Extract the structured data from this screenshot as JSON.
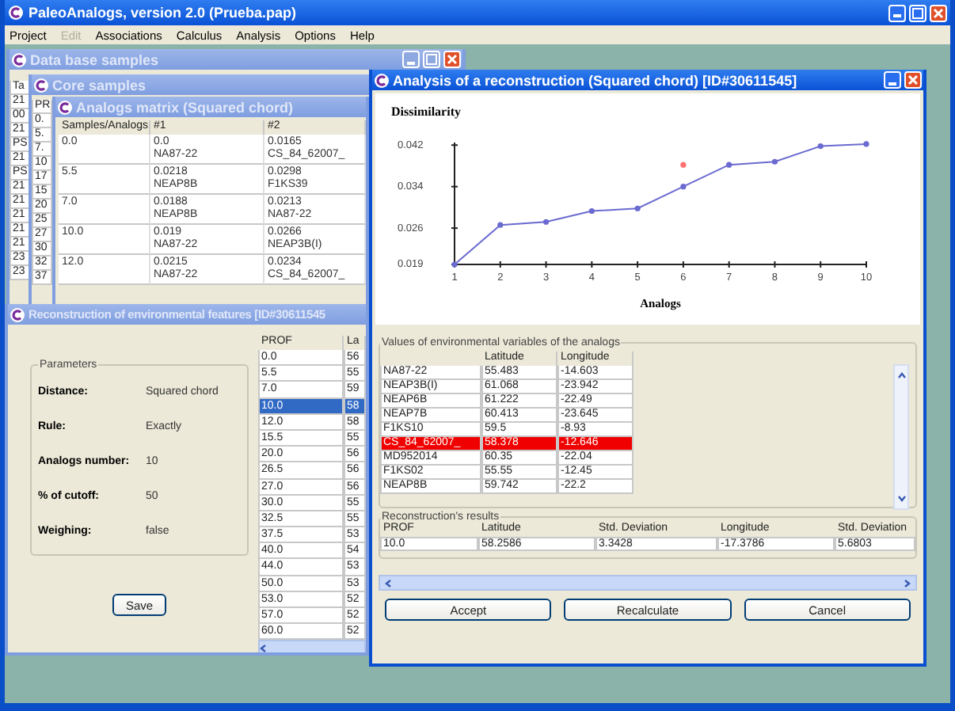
{
  "window": {
    "title": "PaleoAnalogs, version 2.0 (Prueba.pap)"
  },
  "menu": [
    {
      "label": "Project",
      "disabled": false
    },
    {
      "label": "Edit",
      "disabled": true
    },
    {
      "label": "Associations",
      "disabled": false
    },
    {
      "label": "Calculus",
      "disabled": false
    },
    {
      "label": "Analysis",
      "disabled": false
    },
    {
      "label": "Options",
      "disabled": false
    },
    {
      "label": "Help",
      "disabled": false
    }
  ],
  "database_window": {
    "title": "Data base samples",
    "column_1": [
      "Ta",
      "21",
      "00",
      "21",
      "PS",
      "21",
      "PS",
      "21",
      "21",
      "21",
      "21",
      "21",
      "23",
      "23"
    ]
  },
  "core_window": {
    "title": "Core samples",
    "column_1": [
      "PR",
      "0.",
      "5.",
      "7.",
      "10",
      "17",
      "15",
      "20",
      "25",
      "27",
      "30",
      "32",
      "37"
    ]
  },
  "matrix_window": {
    "title": "Analogs matrix (Squared chord)",
    "columns": [
      "Samples/Analogs",
      "#1",
      "#2"
    ],
    "rows": [
      {
        "cells": [
          {
            "value": "0.0"
          },
          {
            "value": "0.0",
            "analog": "NA87-22"
          },
          {
            "value": "0.0165",
            "analog": "CS_84_62007_"
          }
        ]
      },
      {
        "cells": [
          {
            "value": "5.5"
          },
          {
            "value": "0.0218",
            "analog": "NEAP8B"
          },
          {
            "value": "0.0298",
            "analog": "F1KS39"
          }
        ]
      },
      {
        "cells": [
          {
            "value": "7.0"
          },
          {
            "value": "0.0188",
            "analog": "NEAP8B"
          },
          {
            "value": "0.0213",
            "analog": "NA87-22"
          }
        ]
      },
      {
        "cells": [
          {
            "value": "10.0"
          },
          {
            "value": "0.019",
            "analog": "NA87-22"
          },
          {
            "value": "0.0266",
            "analog": "NEAP3B(I)"
          }
        ]
      },
      {
        "cells": [
          {
            "value": "12.0"
          },
          {
            "value": "0.0215",
            "analog": "NA87-22"
          },
          {
            "value": "0.0234",
            "analog": "CS_84_62007_"
          }
        ]
      }
    ]
  },
  "reconstruction_window": {
    "title": "Reconstruction of environmental features [ID#30611545",
    "parameters": {
      "title": "Parameters",
      "items": [
        {
          "label": "Distance:",
          "value": "Squared chord"
        },
        {
          "label": "Rule:",
          "value": "Exactly"
        },
        {
          "label": "Analogs number:",
          "value": "10"
        },
        {
          "label": "% of cutoff:",
          "value": "50"
        },
        {
          "label": "Weighing:",
          "value": "false"
        }
      ]
    },
    "save_button": "Save",
    "columns": [
      "PROF",
      "La"
    ],
    "rows": [
      {
        "prof": "0.0",
        "column_2": "56",
        "selected": false
      },
      {
        "prof": "5.5",
        "column_2": "55",
        "selected": false
      },
      {
        "prof": "7.0",
        "column_2": "59",
        "selected": false
      },
      {
        "prof": "10.0",
        "column_2": "58",
        "selected": true
      },
      {
        "prof": "12.0",
        "column_2": "58",
        "selected": false
      },
      {
        "prof": "15.5",
        "column_2": "55",
        "selected": false
      },
      {
        "prof": "20.0",
        "column_2": "56",
        "selected": false
      },
      {
        "prof": "26.5",
        "column_2": "56",
        "selected": false
      },
      {
        "prof": "27.0",
        "column_2": "56",
        "selected": false
      },
      {
        "prof": "30.0",
        "column_2": "55",
        "selected": false
      },
      {
        "prof": "32.5",
        "column_2": "55",
        "selected": false
      },
      {
        "prof": "37.5",
        "column_2": "53",
        "selected": false
      },
      {
        "prof": "40.0",
        "column_2": "54",
        "selected": false
      },
      {
        "prof": "44.0",
        "column_2": "53",
        "selected": false
      },
      {
        "prof": "50.0",
        "column_2": "53",
        "selected": false
      },
      {
        "prof": "53.0",
        "column_2": "52",
        "selected": false
      },
      {
        "prof": "57.0",
        "column_2": "52",
        "selected": false
      },
      {
        "prof": "60.0",
        "column_2": "52",
        "selected": false
      }
    ]
  },
  "analysis_window": {
    "title": "Analysis of a reconstruction (Squared chord) [ID#30611545]",
    "chart_data": {
      "type": "line",
      "title": "Dissimilarity",
      "xlabel": "Analogs",
      "x": [
        1,
        2,
        3,
        4,
        5,
        6,
        7,
        8,
        9,
        10
      ],
      "series": [
        {
          "color": "#6a6ad0",
          "marker": "circle",
          "values": [
            0.019,
            0.0266,
            0.0272,
            0.0293,
            0.0298,
            0.034,
            0.0382,
            0.0388,
            0.0418,
            0.0422
          ]
        },
        {
          "color": "#ff7070",
          "marker": "circle",
          "values": [
            null,
            null,
            null,
            null,
            null,
            0.0382,
            null,
            null,
            null,
            null
          ]
        }
      ],
      "xlim": [
        1,
        10
      ],
      "ylim": [
        0.019,
        0.0425
      ],
      "xticks": [
        1,
        2,
        3,
        4,
        5,
        6,
        7,
        8,
        9,
        10
      ],
      "yticks": [
        0.019,
        0.026,
        0.034,
        0.042
      ]
    },
    "values_group": {
      "title": "Values of environmental variables of the analogs",
      "columns": [
        "Latitude",
        "Longitude"
      ],
      "rows": [
        {
          "name": "NA87-22",
          "latitude": "55.483",
          "longitude": "-14.603",
          "selected": false
        },
        {
          "name": "NEAP3B(I)",
          "latitude": "61.068",
          "longitude": "-23.942",
          "selected": false
        },
        {
          "name": "NEAP6B",
          "latitude": "61.222",
          "longitude": "-22.49",
          "selected": false
        },
        {
          "name": "NEAP7B",
          "latitude": "60.413",
          "longitude": "-23.645",
          "selected": false
        },
        {
          "name": "F1KS10",
          "latitude": "59.5",
          "longitude": "-8.93",
          "selected": false
        },
        {
          "name": "CS_84_62007_",
          "latitude": "58.378",
          "longitude": "-12.646",
          "selected": true
        },
        {
          "name": "MD952014",
          "latitude": "60.35",
          "longitude": "-22.04",
          "selected": false
        },
        {
          "name": "F1KS02",
          "latitude": "55.55",
          "longitude": "-12.45",
          "selected": false
        },
        {
          "name": "NEAP8B",
          "latitude": "59.742",
          "longitude": "-22.2",
          "selected": false
        }
      ]
    },
    "results_group": {
      "title": "Reconstruction's results",
      "columns": [
        "PROF",
        "Latitude",
        "Std. Deviation",
        "Longitude",
        "Std. Deviation"
      ],
      "values": [
        "10.0",
        "58.2586",
        "3.3428",
        "-17.3786",
        "5.6803"
      ]
    },
    "buttons": [
      "Accept",
      "Recalculate",
      "Cancel"
    ]
  }
}
